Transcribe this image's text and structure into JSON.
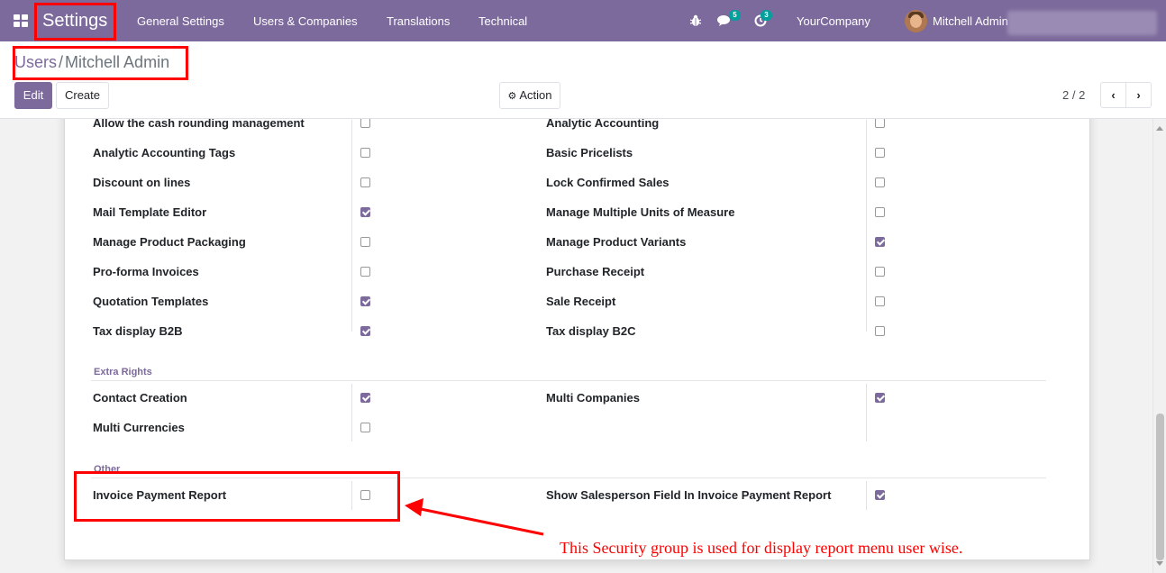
{
  "navbar": {
    "brand": "Settings",
    "menus": [
      "General Settings",
      "Users & Companies",
      "Translations",
      "Technical"
    ],
    "messages_badge": "5",
    "activities_badge": "3",
    "company": "YourCompany",
    "user": "Mitchell Admin"
  },
  "breadcrumb": {
    "parent": "Users",
    "separator": "/",
    "current": "Mitchell Admin"
  },
  "buttons": {
    "edit": "Edit",
    "create": "Create",
    "action": "Action"
  },
  "pager": {
    "value": "2 / 2"
  },
  "settings": {
    "rows": [
      {
        "left": "Allow the cash rounding management",
        "left_checked": false,
        "right": "Analytic Accounting",
        "right_checked": false
      },
      {
        "left": "Analytic Accounting Tags",
        "left_checked": false,
        "right": "Basic Pricelists",
        "right_checked": false
      },
      {
        "left": "Discount on lines",
        "left_checked": false,
        "right": "Lock Confirmed Sales",
        "right_checked": false
      },
      {
        "left": "Mail Template Editor",
        "left_checked": true,
        "right": "Manage Multiple Units of Measure",
        "right_checked": false
      },
      {
        "left": "Manage Product Packaging",
        "left_checked": false,
        "right": "Manage Product Variants",
        "right_checked": true
      },
      {
        "left": "Pro-forma Invoices",
        "left_checked": false,
        "right": "Purchase Receipt",
        "right_checked": false
      },
      {
        "left": "Quotation Templates",
        "left_checked": true,
        "right": "Sale Receipt",
        "right_checked": false
      },
      {
        "left": "Tax display B2B",
        "left_checked": true,
        "right": "Tax display B2C",
        "right_checked": false
      }
    ],
    "extra_rights": {
      "title": "Extra Rights",
      "rows": [
        {
          "left": "Contact Creation",
          "left_checked": true,
          "right": "Multi Companies",
          "right_checked": true
        },
        {
          "left": "Multi Currencies",
          "left_checked": false
        }
      ]
    },
    "other": {
      "title": "Other",
      "rows": [
        {
          "left": "Invoice Payment Report",
          "left_checked": false,
          "right": "Show Salesperson Field In Invoice Payment Report",
          "right_checked": true
        }
      ]
    }
  },
  "annotation": {
    "text": "This Security group is used for display report menu user wise.",
    "color": "#ff0000"
  },
  "colors": {
    "brand": "#7c6a9c",
    "badge": "#00a09d",
    "highlight": "#ff0000"
  }
}
